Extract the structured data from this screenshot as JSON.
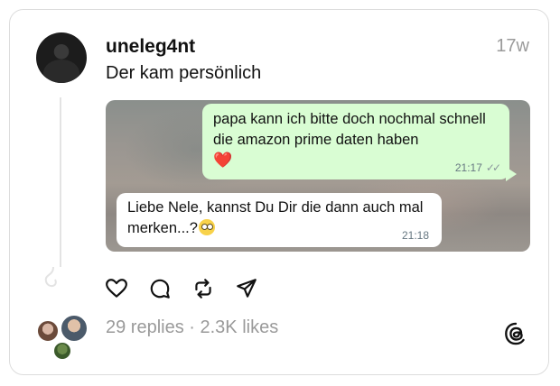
{
  "post": {
    "username": "uneleg4nt",
    "time": "17w",
    "text": "Der kam persönlich"
  },
  "chat": {
    "outgoing": {
      "text": "papa kann ich bitte doch nochmal schnell die amazon prime daten haben",
      "emoji": "❤️",
      "time": "21:17",
      "status_icon": "double-check-icon"
    },
    "incoming": {
      "text": "Liebe Nele, kannst Du Dir die dann auch mal merken...?",
      "emoji": "flushed-face",
      "time": "21:18"
    }
  },
  "actions": {
    "icons": [
      "heart-icon",
      "comment-icon",
      "repost-icon",
      "share-icon"
    ]
  },
  "stats": {
    "text": "29 replies · 2.3K likes"
  },
  "colors": {
    "outgoing_bubble": "#d9fdd3",
    "incoming_bubble": "#ffffff",
    "muted_text": "#9a9a9a"
  }
}
